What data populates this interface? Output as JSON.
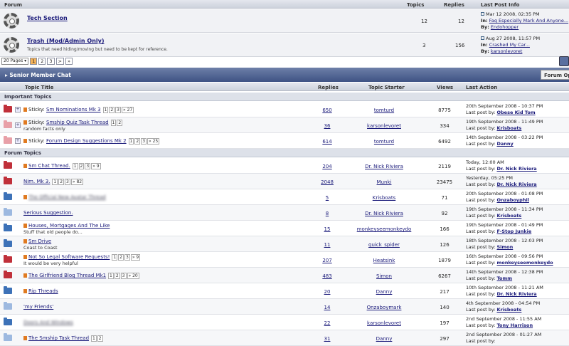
{
  "forum_header": {
    "forum": "Forum",
    "topics": "Topics",
    "replies": "Replies",
    "last_post_info": "Last Post Info"
  },
  "forums": [
    {
      "title": "Tech Section",
      "desc": "",
      "topics": "12",
      "replies": "12",
      "date": "Mar 12 2008, 02:35 PM",
      "in_label": "In:",
      "in": "Faq Especially Mark And Anyone...",
      "by_label": "By:",
      "by": "Endohopper"
    },
    {
      "title": "Trash (Mod/Admin Only)",
      "desc": "Topics that need hiding/moving but need to be kept for reference.",
      "topics": "3",
      "replies": "156",
      "date": "Aug 27 2008, 11:57 PM",
      "in_label": "In:",
      "in": "Crashed My Car...",
      "by_label": "By:",
      "by": "karsonlevoret"
    }
  ],
  "pager": {
    "select": "20 Pages",
    "pages": [
      "1",
      "2",
      "3",
      ">",
      "»"
    ]
  },
  "topic_bar": {
    "title": "Senior Member Chat",
    "options": "Forum Op"
  },
  "topic_header": {
    "title": "Topic Title",
    "replies": "Replies",
    "starter": "Topic Starter",
    "views": "Views",
    "last_action": "Last Action"
  },
  "sections": {
    "important": "Important Topics",
    "forum": "Forum Topics"
  },
  "important": [
    {
      "prefix": "Sticky:",
      "title": "Sm Nominations Mk 3",
      "pages": [
        "1",
        "2",
        "3",
        "» 27"
      ],
      "sub": "",
      "replies": "650",
      "starter": "tomturd",
      "views": "8775",
      "date": "20th September 2008 - 10:37 PM",
      "lp": "Last post by:",
      "by": "Obese Kid Tom"
    },
    {
      "prefix": "Sticky:",
      "title": "Smship Quiz Task Thread",
      "pages": [
        "1",
        "2"
      ],
      "sub": "random facts only",
      "replies": "36",
      "starter": "karsonlevoret",
      "views": "334",
      "date": "19th September 2008 - 11:49 PM",
      "lp": "Last post by:",
      "by": "Krisboats"
    },
    {
      "prefix": "Sticky:",
      "title": "Forum Design Suggestions Mk 2",
      "pages": [
        "1",
        "2",
        "3",
        "» 25"
      ],
      "sub": "",
      "replies": "614",
      "starter": "tomturd",
      "views": "6492",
      "date": "14th September 2008 - 03:22 PM",
      "lp": "Last post by:",
      "by": "Danny"
    }
  ],
  "topics": [
    {
      "title": "Sm Chat Thread.",
      "pages": [
        "1",
        "2",
        "3",
        "» 9"
      ],
      "sub": "",
      "replies": "204",
      "starter": "Dr. Nick Riviera",
      "views": "2119",
      "date": "Today, 12:00 AM",
      "lp": "Last post by:",
      "by": "Dr. Nick Riviera"
    },
    {
      "title": "Nim. Mk 3.",
      "pages": [
        "1",
        "2",
        "3",
        "» 82"
      ],
      "sub": "",
      "replies": "2048",
      "starter": "Munki",
      "views": "23475",
      "date": "Yesterday, 05:25 PM",
      "lp": "Last post by:",
      "by": "Dr. Nick Riviera"
    },
    {
      "title": "The Official New Avatar Thread",
      "pages": [],
      "sub": "",
      "replies": "5",
      "starter": "Krisboats",
      "views": "71",
      "date": "20th September 2008 - 01:08 PM",
      "lp": "Last post by:",
      "by": "Onzaboyphil"
    },
    {
      "title": "Serious Suggestion.",
      "pages": [],
      "sub": "",
      "replies": "8",
      "starter": "Dr. Nick Riviera",
      "views": "92",
      "date": "19th September 2008 - 11:34 PM",
      "lp": "Last post by:",
      "by": "Krisboats"
    },
    {
      "title": "Houses, Mortgages And The Like",
      "pages": [],
      "sub": "Stuff that old people do...",
      "replies": "15",
      "starter": "monkeyseemonkeydo",
      "views": "166",
      "date": "19th September 2008 - 01:49 PM",
      "lp": "Last post by:",
      "by": "F-Stop Junkie"
    },
    {
      "title": "Sm Drive",
      "pages": [],
      "sub": "Coast to Coast",
      "replies": "11",
      "starter": "quick_spider",
      "views": "126",
      "date": "18th September 2008 - 12:03 PM",
      "lp": "Last post by:",
      "by": "Simon"
    },
    {
      "title": "Not So Legal Software Requests!",
      "pages": [
        "1",
        "2",
        "3",
        "» 9"
      ],
      "sub": "It would be very helpful",
      "replies": "207",
      "starter": "Heatsink",
      "views": "1879",
      "date": "16th September 2008 - 09:56 PM",
      "lp": "Last post by:",
      "by": "monkeyseemonkeydo"
    },
    {
      "title": "The Girlfriend Blog Thread Mk1",
      "pages": [
        "1",
        "2",
        "3",
        "» 20"
      ],
      "sub": "",
      "replies": "483",
      "starter": "Simon",
      "views": "6267",
      "date": "14th September 2008 - 12:38 PM",
      "lp": "Last post by:",
      "by": "Tomm"
    },
    {
      "title": "Rip Threads",
      "pages": [],
      "sub": "",
      "replies": "20",
      "starter": "Danny",
      "views": "217",
      "date": "10th September 2008 - 11:21 AM",
      "lp": "Last post by:",
      "by": "Dr. Nick Riviera"
    },
    {
      "title": "'my Friends'",
      "pages": [],
      "sub": "",
      "replies": "14",
      "starter": "Onzaboymark",
      "views": "140",
      "date": "4th September 2008 - 04:54 PM",
      "lp": "Last post by:",
      "by": "Krisboats"
    },
    {
      "title": "Doors And Windows",
      "pages": [],
      "sub": "",
      "replies": "22",
      "starter": "karsonlevoret",
      "views": "197",
      "date": "2nd September 2008 - 11:55 AM",
      "lp": "Last post by:",
      "by": "Tony Harrison"
    },
    {
      "title": "The Smship Task Thread",
      "pages": [
        "1",
        "2"
      ],
      "sub": "",
      "replies": "31",
      "starter": "Danny",
      "views": "297",
      "date": "2nd September 2008 - 01:27 AM",
      "lp": "Last post by:",
      "by": ""
    }
  ]
}
